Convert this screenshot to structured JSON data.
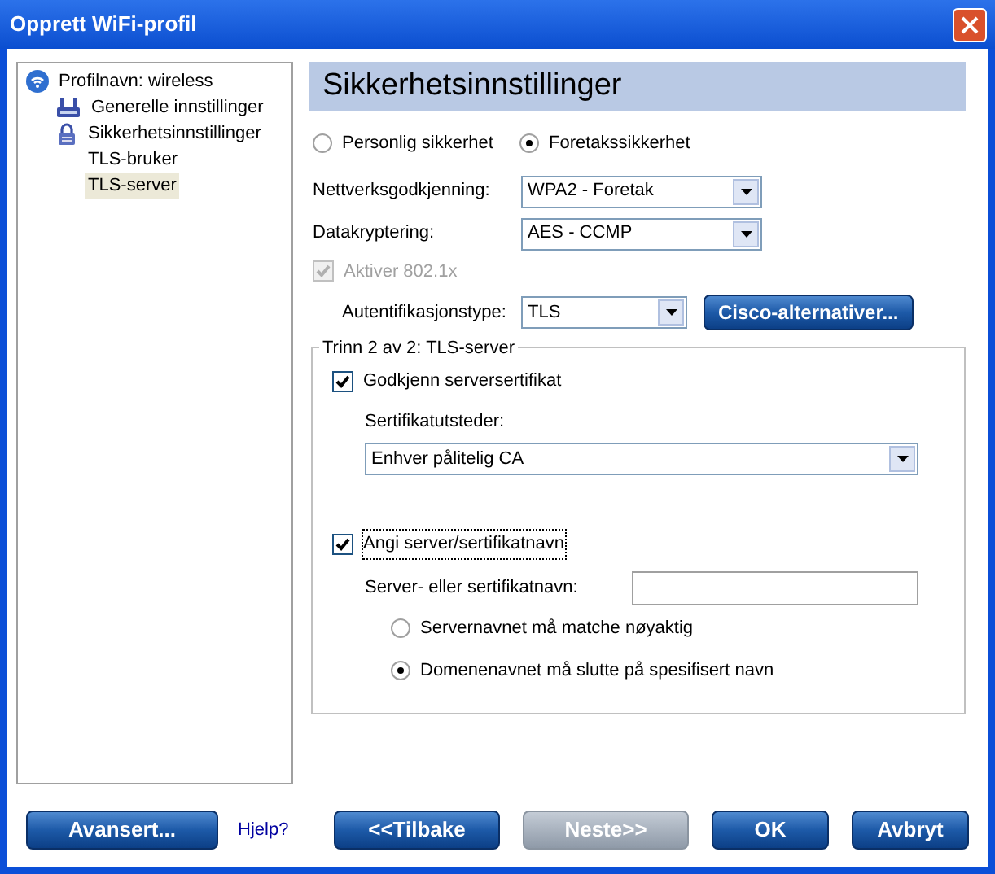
{
  "window": {
    "title": "Opprett WiFi-profil"
  },
  "tree": [
    {
      "label": "Profilnavn: wireless",
      "kind": "wifi",
      "selected": false,
      "children": [
        {
          "label": "Generelle innstillinger",
          "kind": "network",
          "selected": false
        },
        {
          "label": "Sikkerhetsinnstillinger",
          "kind": "lock",
          "selected": false,
          "children": [
            {
              "label": "TLS-bruker",
              "selected": false
            },
            {
              "label": "TLS-server",
              "selected": true
            }
          ]
        }
      ]
    }
  ],
  "header": "Sikkerhetsinnstillinger",
  "security_mode": [
    {
      "label": "Personlig sikkerhet",
      "selected": false
    },
    {
      "label": "Foretakssikkerhet",
      "selected": true
    }
  ],
  "network_auth": {
    "label": "Nettverksgodkjenning:",
    "value": "WPA2 - Foretak"
  },
  "data_encryption": {
    "label": "Datakryptering:",
    "value": "AES - CCMP"
  },
  "enable_8021x": {
    "label": "Aktiver 802.1x",
    "checked": true,
    "disabled": true
  },
  "auth_type": {
    "label": "Autentifikasjonstype:",
    "value": "TLS"
  },
  "cisco_button": "Cisco-alternativer...",
  "group": {
    "title": "Trinn 2 av 2: TLS-server",
    "verify_cert": {
      "label": "Godkjenn serversertifikat",
      "checked": true
    },
    "issuer_label": "Sertifikatutsteder:",
    "issuer_value": "Enhver pålitelig CA",
    "specify_name": {
      "label": "Angi server/sertifikatnavn",
      "checked": true
    },
    "name_label": "Server- eller sertifikatnavn:",
    "match_options": [
      {
        "label": "Servernavnet må matche nøyaktig",
        "selected": false
      },
      {
        "label": "Domenenavnet må slutte på spesifisert navn",
        "selected": true
      }
    ]
  },
  "footer": {
    "advanced": {
      "label": "Avansert...",
      "disabled": false
    },
    "help": "Hjelp?",
    "buttons": [
      {
        "label": "<<Tilbake",
        "disabled": false
      },
      {
        "label": "Neste>>",
        "disabled": true
      },
      {
        "label": "OK",
        "disabled": false
      },
      {
        "label": "Avbryt",
        "disabled": false
      }
    ]
  }
}
